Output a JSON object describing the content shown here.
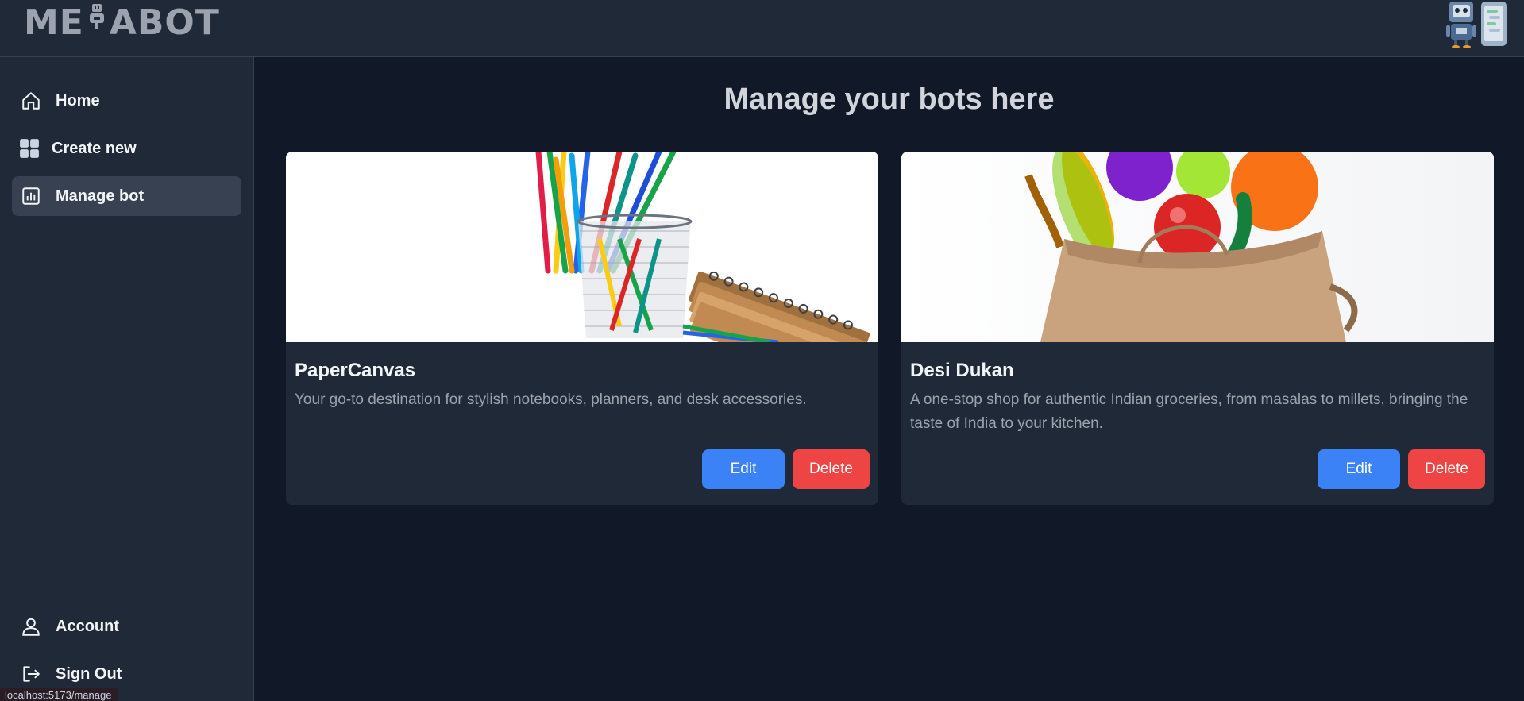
{
  "header": {
    "logo_left": "ME",
    "logo_right": "ABOT"
  },
  "sidebar": {
    "items": [
      {
        "label": "Home",
        "icon": "home-icon"
      },
      {
        "label": "Create new",
        "icon": "grid-icon"
      },
      {
        "label": "Manage bot",
        "icon": "chart-icon",
        "active": true
      }
    ],
    "bottom": [
      {
        "label": "Account",
        "icon": "user-icon"
      },
      {
        "label": "Sign Out",
        "icon": "sign-out-icon"
      }
    ]
  },
  "main": {
    "title": "Manage your bots here",
    "bots": [
      {
        "name": "PaperCanvas",
        "description": "Your go-to destination for stylish notebooks, planners, and desk accessories.",
        "edit_label": "Edit",
        "delete_label": "Delete"
      },
      {
        "name": "Desi Dukan",
        "description": "A one-stop shop for authentic Indian groceries, from masalas to millets, bringing the taste of India to your kitchen.",
        "edit_label": "Edit",
        "delete_label": "Delete"
      }
    ]
  },
  "status_bar": {
    "url": "localhost:5173/manage"
  },
  "colors": {
    "background": "#111827",
    "panel": "#1f2937",
    "active": "#374151",
    "edit": "#3b82f6",
    "delete": "#ef4444"
  }
}
